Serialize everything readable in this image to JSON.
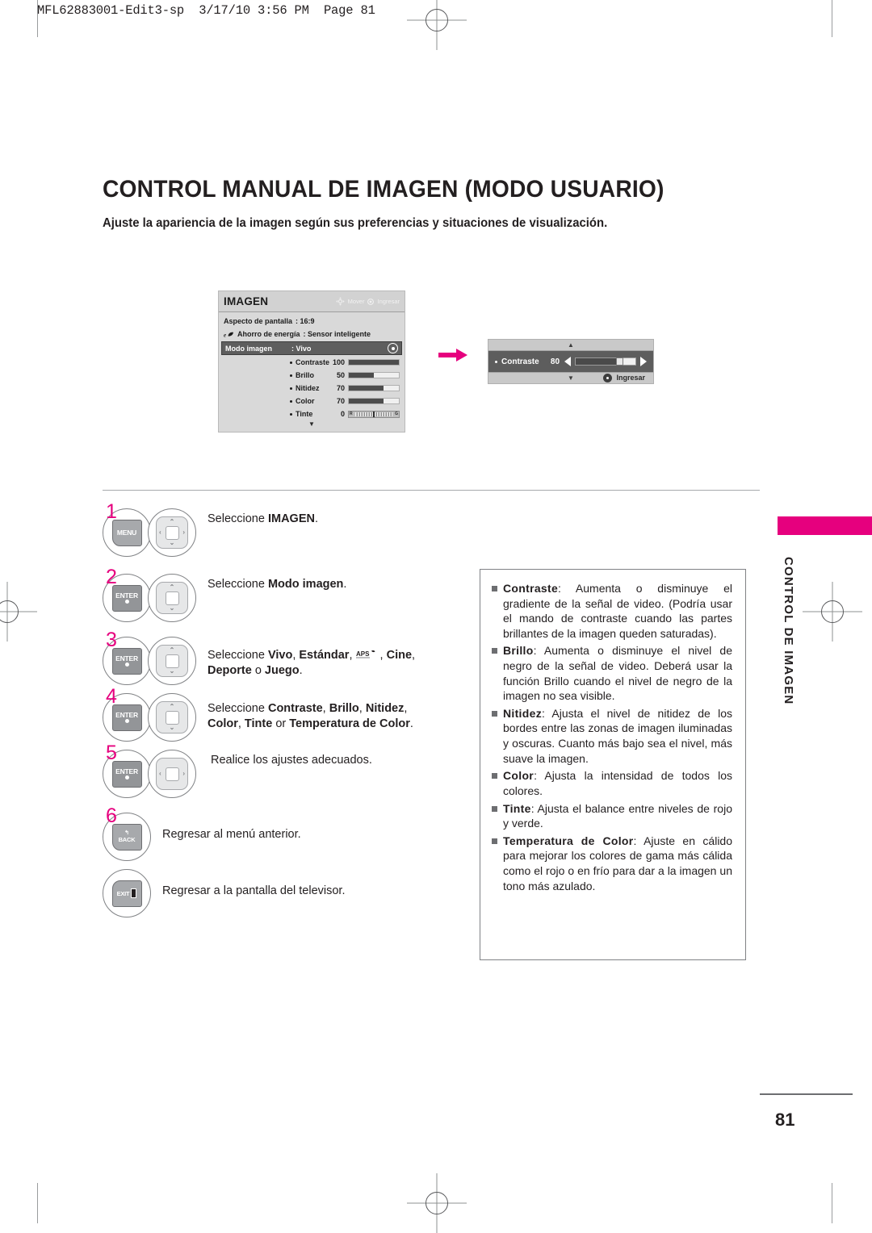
{
  "slug": "MFL62883001-Edit3-sp  3/17/10 3:56 PM  Page 81",
  "page": {
    "title": "CONTROL MANUAL DE IMAGEN (MODO USUARIO)",
    "subtitle": "Ajuste la apariencia de la imagen según sus preferencias y situaciones de visualización.",
    "number": "81",
    "side_tab": "CONTROL DE IMAGEN",
    "accent_color": "#e6007e"
  },
  "osd": {
    "title": "IMAGEN",
    "hint_move": "Mover",
    "hint_enter": "Ingresar",
    "rows": [
      {
        "label": "Aspecto de pantalla",
        "value": ": 16:9"
      },
      {
        "label": "Ahorro de energía",
        "value": ": Sensor inteligente"
      },
      {
        "label": "Modo imagen",
        "value": ": Vivo"
      }
    ],
    "items": [
      {
        "name": "Contraste",
        "value": "100",
        "pct": 100
      },
      {
        "name": "Brillo",
        "value": "50",
        "pct": 50
      },
      {
        "name": "Nitidez",
        "value": "70",
        "pct": 70
      },
      {
        "name": "Color",
        "value": "70",
        "pct": 70
      },
      {
        "name": "Tinte",
        "value": "0",
        "left": "R",
        "right": "G"
      }
    ],
    "scroll_down": "▼"
  },
  "popup": {
    "name": "Contraste",
    "value": "80",
    "pct": 80,
    "enter_label": "Ingresar",
    "up": "▲",
    "down": "▼"
  },
  "steps": [
    {
      "num": "1",
      "key": "MENU",
      "pad": "four-way",
      "text_pre": "Seleccione ",
      "text_bold": "IMAGEN",
      "text_post": "."
    },
    {
      "num": "2",
      "key": "ENTER",
      "pad": "vertical",
      "text_pre": "Seleccione ",
      "text_bold": "Modo imagen",
      "text_post": "."
    },
    {
      "num": "3",
      "key": "ENTER",
      "pad": "vertical",
      "text_pre": "Seleccione ",
      "text_bold": "Vivo",
      "text_mid1": ", ",
      "text_bold2": "Estándar",
      "text_mid2": ", ",
      "text_icon": "aps-icon",
      "text_mid3": " , ",
      "text_bold3": "Cine",
      "text_mid4": ", ",
      "text_bold4": "Deporte",
      "text_mid5": " o ",
      "text_bold5": "Juego",
      "text_post": "."
    },
    {
      "num": "4",
      "key": "ENTER",
      "pad": "vertical",
      "text_pre": "Seleccione  ",
      "text_bold": "Contraste",
      "text_mid1": ",  ",
      "text_bold2": "Brillo",
      "text_mid2": ",  ",
      "text_bold3": "Nitidez",
      "text_mid3": ", ",
      "text_bold4": "Color",
      "text_mid4": ", ",
      "text_bold5": "Tinte",
      "text_mid5": " or ",
      "text_bold6": "Temperatura de Color",
      "text_post": "."
    },
    {
      "num": "5",
      "key": "ENTER",
      "pad": "horizontal",
      "text_pre": "Realice los ajustes adecuados.",
      "text_bold": "",
      "text_post": ""
    },
    {
      "num": "6",
      "key": "BACK",
      "pad": "none",
      "text_pre": "Regresar al menú anterior.",
      "text_bold": "",
      "text_post": ""
    },
    {
      "num": "",
      "key": "EXIT",
      "pad": "none",
      "text_pre": "Regresar a la pantalla del televisor.",
      "text_bold": "",
      "text_post": ""
    }
  ],
  "info": [
    {
      "term": "Contraste",
      "body": ": Aumenta o disminuye el gradiente de la señal de video. (Podría usar el mando de contraste cuando las partes brillantes de la imagen queden saturadas)."
    },
    {
      "term": "Brillo",
      "body": ": Aumenta o disminuye el nivel de negro de la señal de video. Deberá usar la función Brillo cuando el nivel de negro de la imagen no sea visible."
    },
    {
      "term": "Nitidez",
      "body": ": Ajusta el nivel de nitidez de los bordes entre las zonas de imagen iluminadas y oscuras.  Cuanto más bajo sea el nivel, más suave la imagen."
    },
    {
      "term": "Color",
      "body": ": Ajusta la intensidad de todos los colores."
    },
    {
      "term": "Tinte",
      "body": ": Ajusta el balance entre niveles de rojo y verde."
    },
    {
      "term": "Temperatura de Color",
      "body": ": Ajuste en cálido para mejorar los colores de gama más cálida como el rojo o en frío para dar a la imagen un tono más azulado."
    }
  ]
}
